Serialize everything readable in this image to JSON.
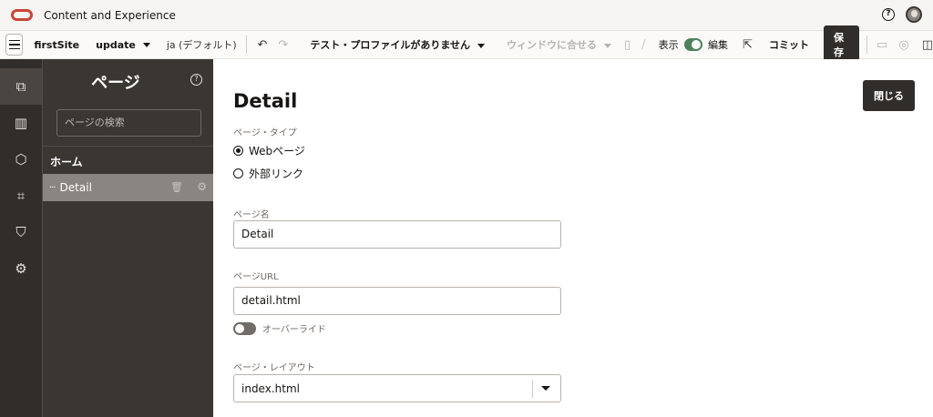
{
  "app": {
    "title": "Content and Experience"
  },
  "toolbar": {
    "site": "firstSite",
    "update": "update",
    "language": "ja (デフォルト)",
    "test_profile": "テスト・プロファイルがありません",
    "fit_window": "ウィンドウに合せる",
    "view_label": "表示",
    "edit_label": "編集",
    "commit": "コミット",
    "save": "保存"
  },
  "panel": {
    "title": "ページ",
    "search_placeholder": "ページの検索",
    "home": "ホーム",
    "selected_page": "Detail"
  },
  "main": {
    "close": "閉じる",
    "title": "Detail",
    "page_type_label": "ページ・タイプ",
    "page_type_web": "Webページ",
    "page_type_external": "外部リンク",
    "page_name_label": "ページ名",
    "page_name_value": "Detail",
    "page_url_label": "ページURL",
    "page_url_value": "detail.html",
    "override_label": "オーバーライド",
    "layout_label": "ページ・レイアウト",
    "layout_value": "index.html"
  },
  "colors": {
    "brand": "#c74634",
    "rail": "#312d2a",
    "panel": "#3a3632",
    "toggle_on": "#4c825c"
  }
}
